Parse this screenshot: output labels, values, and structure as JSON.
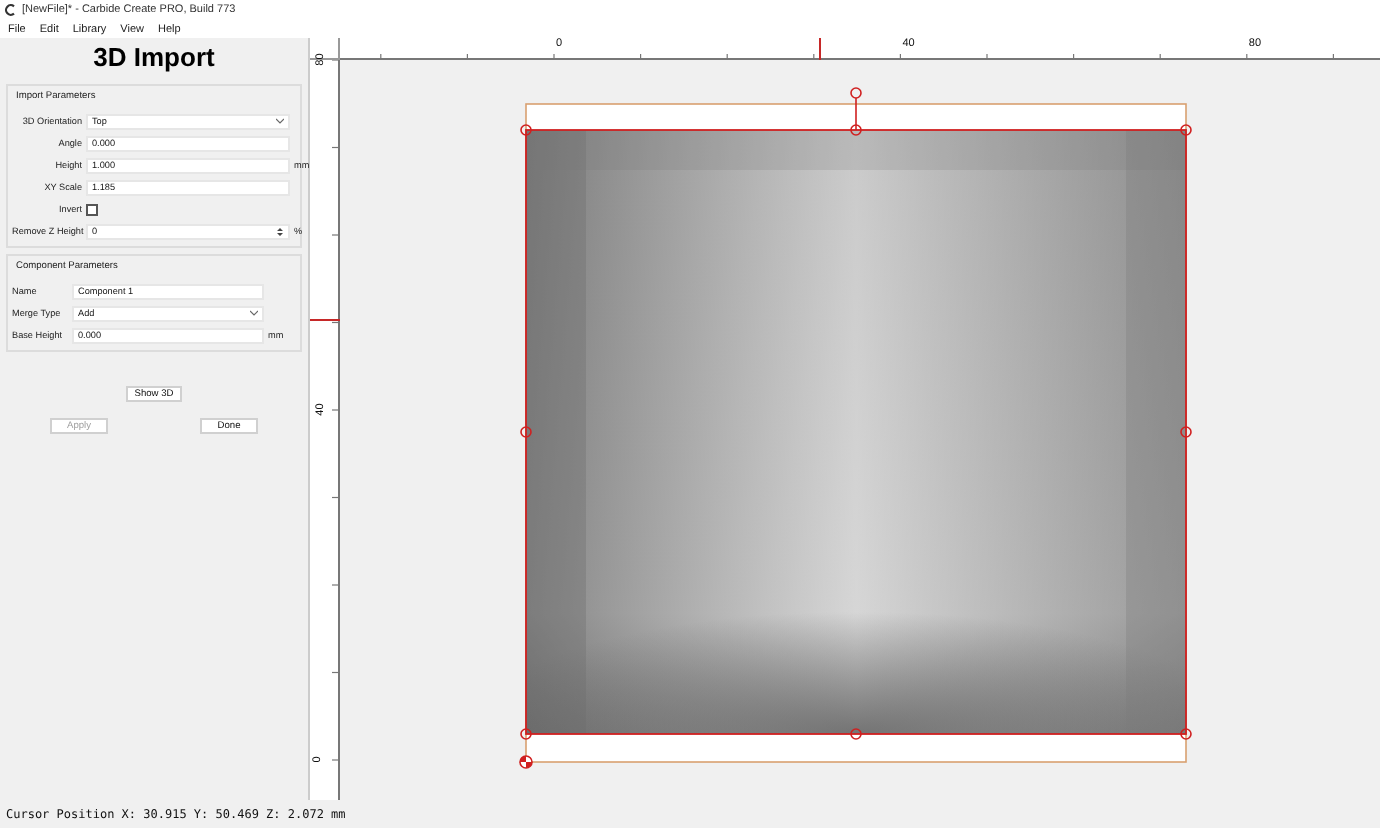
{
  "window": {
    "title": "[NewFile]* - Carbide Create PRO, Build 773"
  },
  "menu": [
    "File",
    "Edit",
    "Library",
    "View",
    "Help"
  ],
  "panel": {
    "title": "3D Import",
    "groups": [
      {
        "title": "Import Parameters",
        "fields": [
          {
            "kind": "select",
            "label": "3D Orientation",
            "value": "Top"
          },
          {
            "kind": "text",
            "label": "Angle",
            "value": "0.000"
          },
          {
            "kind": "text",
            "label": "Height",
            "value": "1.000",
            "unit": "mm"
          },
          {
            "kind": "text",
            "label": "XY Scale",
            "value": "1.185"
          },
          {
            "kind": "checkbox",
            "label": "Invert",
            "checked": false
          },
          {
            "kind": "spin",
            "label": "Remove Z Height",
            "value": "0",
            "unit": "%"
          }
        ]
      },
      {
        "title": "Component Parameters",
        "fields": [
          {
            "kind": "text",
            "label": "Name",
            "value": "Component 1"
          },
          {
            "kind": "select",
            "label": "Merge Type",
            "value": "Add"
          },
          {
            "kind": "text",
            "label": "Base Height",
            "value": "0.000",
            "unit": "mm"
          }
        ]
      }
    ],
    "show_button": {
      "label": "Show 3D",
      "disabled": false
    },
    "actions": [
      {
        "label": "Apply",
        "disabled": true
      },
      {
        "label": "Done",
        "disabled": false
      }
    ]
  },
  "rulers": {
    "horizontal": [
      "0",
      "40",
      "80"
    ],
    "vertical": [
      "80",
      "40",
      "0"
    ]
  },
  "status_bar": "Cursor Position X: 30.915 Y: 50.469 Z: 2.072 mm"
}
